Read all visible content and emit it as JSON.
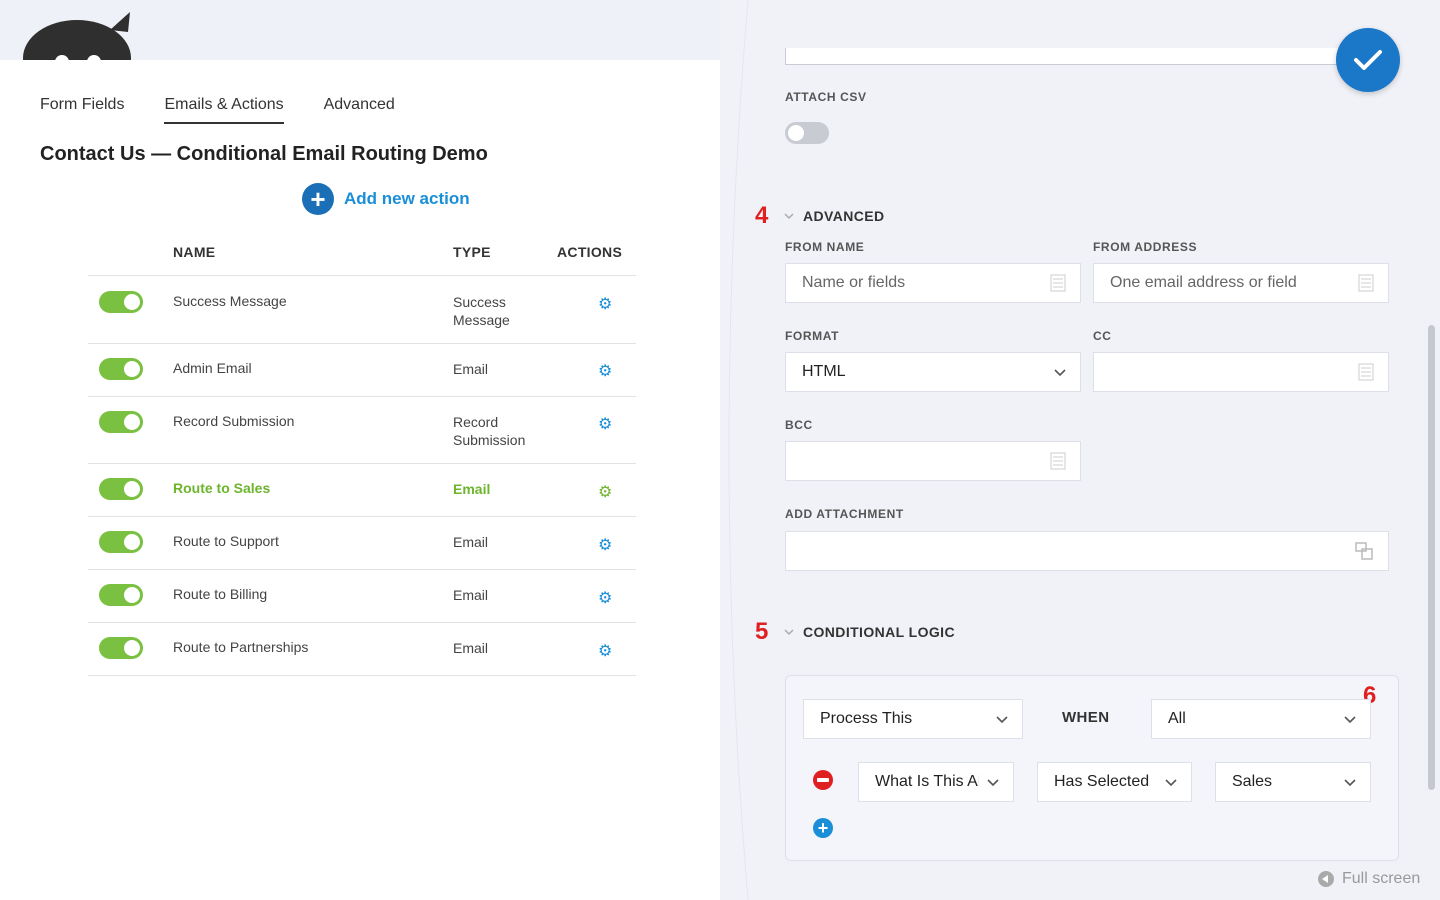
{
  "tabs": [
    {
      "label": "Form Fields"
    },
    {
      "label": "Emails & Actions"
    },
    {
      "label": "Advanced"
    }
  ],
  "form_title": "Contact Us — Conditional Email Routing Demo",
  "add_action_label": "Add new action",
  "table": {
    "headers": {
      "name": "NAME",
      "type": "TYPE",
      "actions": "ACTIONS"
    },
    "rows": [
      {
        "name": "Success Message",
        "type": "Success Message",
        "enabled": true
      },
      {
        "name": "Admin Email",
        "type": "Email",
        "enabled": true
      },
      {
        "name": "Record Submission",
        "type": "Record Submission",
        "enabled": true
      },
      {
        "name": "Route to Sales",
        "type": "Email",
        "enabled": true
      },
      {
        "name": "Route to Support",
        "type": "Email",
        "enabled": true
      },
      {
        "name": "Route to Billing",
        "type": "Email",
        "enabled": true
      },
      {
        "name": "Route to Partnerships",
        "type": "Email",
        "enabled": true
      }
    ]
  },
  "drawer": {
    "attach_csv_label": "ATTACH CSV",
    "advanced": {
      "step": "4",
      "heading": "ADVANCED",
      "from_name_label": "FROM NAME",
      "from_name_placeholder": "Name or fields",
      "from_address_label": "FROM ADDRESS",
      "from_address_placeholder": "One email address or field",
      "format_label": "FORMAT",
      "format_value": "HTML",
      "cc_label": "CC",
      "bcc_label": "BCC",
      "add_attachment_label": "ADD ATTACHMENT"
    },
    "conditional": {
      "step": "5",
      "heading": "CONDITIONAL LOGIC",
      "step_box": "6",
      "process_value": "Process This",
      "when_label": "WHEN",
      "when_value": "All",
      "condition_field": "What Is This About?",
      "condition_operator": "Has Selected",
      "condition_value": "Sales"
    },
    "fullscreen_label": "Full screen"
  },
  "colors": {
    "accent_blue": "#1a8fd8",
    "toggle_green": "#7ac142",
    "highlight_green": "#6cb52d",
    "step_red": "#e02020"
  }
}
